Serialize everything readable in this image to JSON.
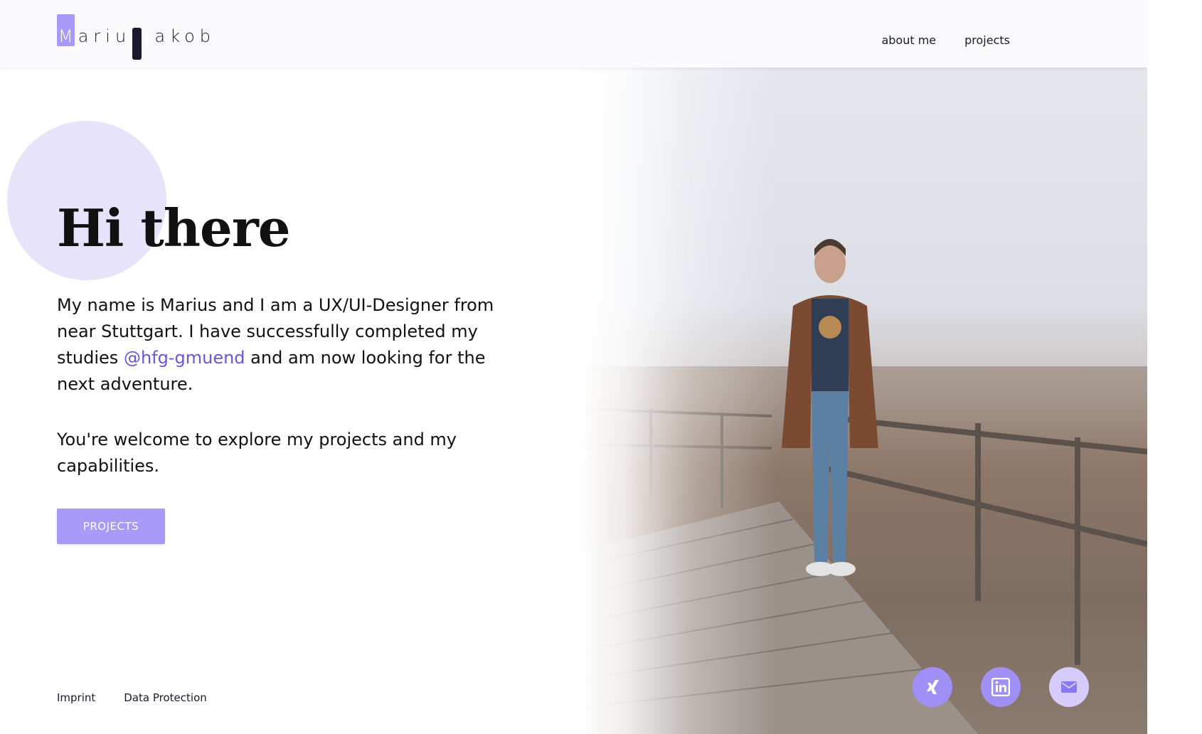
{
  "brand": {
    "first": "Marius",
    "last": "jakob",
    "accent": "#a89af8",
    "dark": "#1a1a2e"
  },
  "nav": {
    "items": [
      {
        "label": "about me"
      },
      {
        "label": "projects"
      }
    ]
  },
  "hero": {
    "title": "Hi there",
    "intro_before": "My name is Marius and I am a UX/UI-Designer from near Stuttgart. I have successfully completed my studies ",
    "intro_link": "@hfg-gmuend",
    "intro_after": " and am now looking for the next adventure.",
    "invite": "You're welcome to explore my projects and my capabilities.",
    "cta_label": "PROJECTS",
    "link_color": "#6a55e0"
  },
  "footer": {
    "imprint": "Imprint",
    "data_protection": "Data Protection"
  },
  "social": {
    "items": [
      {
        "icon": "xing-icon"
      },
      {
        "icon": "linkedin-icon"
      },
      {
        "icon": "mail-icon"
      }
    ]
  }
}
